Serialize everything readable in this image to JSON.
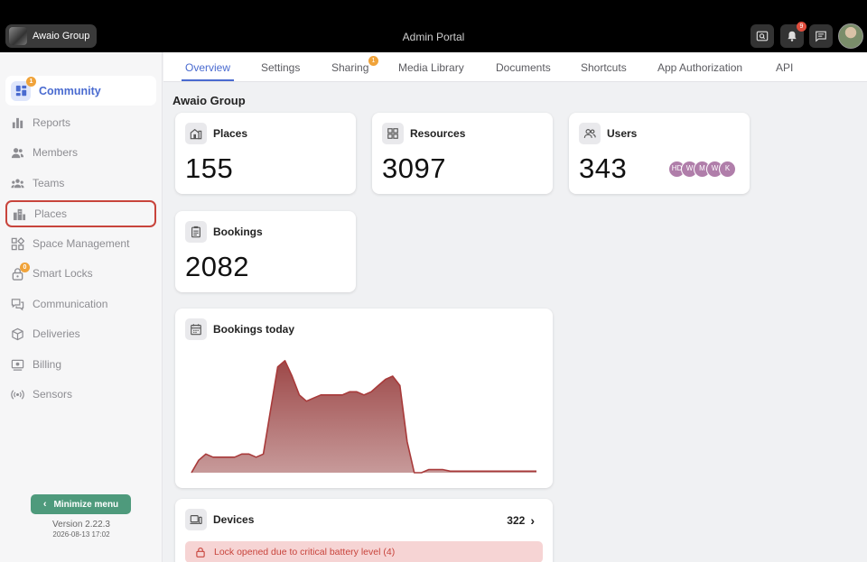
{
  "app": {
    "org_name": "Awaio Group",
    "portal_title": "Admin Portal",
    "notification_count": "9"
  },
  "sidebar": {
    "items": [
      {
        "label": "Community",
        "icon": "grid-icon",
        "badge": "1"
      },
      {
        "label": "Reports",
        "icon": "bar-chart-icon"
      },
      {
        "label": "Members",
        "icon": "members-icon"
      },
      {
        "label": "Teams",
        "icon": "teams-icon"
      },
      {
        "label": "Places",
        "icon": "buildings-icon"
      },
      {
        "label": "Space Management",
        "icon": "shapes-icon"
      },
      {
        "label": "Smart Locks",
        "icon": "lock-icon",
        "badge": "0"
      },
      {
        "label": "Communication",
        "icon": "chat-icon"
      },
      {
        "label": "Deliveries",
        "icon": "box-icon"
      },
      {
        "label": "Billing",
        "icon": "billing-icon"
      },
      {
        "label": "Sensors",
        "icon": "sensor-icon"
      }
    ],
    "minimize_label": "Minimize menu",
    "version": "Version 2.22.3",
    "build_date": "2026-08-13 17:02"
  },
  "tabs": [
    {
      "label": "Overview"
    },
    {
      "label": "Settings"
    },
    {
      "label": "Sharing",
      "badge": "1"
    },
    {
      "label": "Media Library"
    },
    {
      "label": "Documents"
    },
    {
      "label": "Shortcuts"
    },
    {
      "label": "App Authorization"
    },
    {
      "label": "API"
    }
  ],
  "page": {
    "title": "Awaio Group",
    "cards": {
      "places": {
        "label": "Places",
        "value": "155"
      },
      "resources": {
        "label": "Resources",
        "value": "3097"
      },
      "users": {
        "label": "Users",
        "value": "343",
        "avatars": [
          "HD",
          "W",
          "M",
          "W",
          "K"
        ]
      },
      "bookings": {
        "label": "Bookings",
        "value": "2082"
      },
      "bookings_today": {
        "label": "Bookings today"
      },
      "devices": {
        "label": "Devices",
        "count": "322",
        "alert": "Lock opened due to critical battery level (4)"
      }
    }
  },
  "colors": {
    "accent": "#4a6bd0",
    "chart_fill_top": "#9d4848",
    "chart_fill_bottom": "#c79a9a",
    "chart_line": "#a83a3a",
    "alert_bg": "#f6d4d4",
    "alert_text": "#c8443c",
    "minimize_btn": "#4e9a7c"
  },
  "chart_data": {
    "type": "area",
    "title": "Bookings today",
    "x": [
      0,
      1,
      2,
      3,
      4,
      5,
      6,
      7,
      8,
      9,
      10,
      11,
      12,
      13,
      14,
      15,
      16,
      17,
      18,
      19,
      20,
      21,
      22,
      23,
      24,
      25,
      26,
      27,
      28,
      29,
      30,
      31,
      32,
      33,
      34,
      35,
      36,
      37,
      38,
      39,
      40,
      41,
      42,
      43,
      44,
      45,
      46,
      47,
      48
    ],
    "values": [
      0,
      4,
      6,
      5,
      5,
      5,
      5,
      6,
      6,
      5,
      6,
      20,
      34,
      36,
      31,
      25,
      23,
      24,
      25,
      25,
      25,
      25,
      26,
      26,
      25,
      26,
      28,
      30,
      31,
      28,
      10,
      0,
      0,
      1,
      1,
      1,
      0.5,
      0.5,
      0.5,
      0.5,
      0.5,
      0.5,
      0.5,
      0.5,
      0.5,
      0.5,
      0.5,
      0.5,
      0.5
    ],
    "ylim": [
      0,
      40
    ],
    "grid": false
  }
}
